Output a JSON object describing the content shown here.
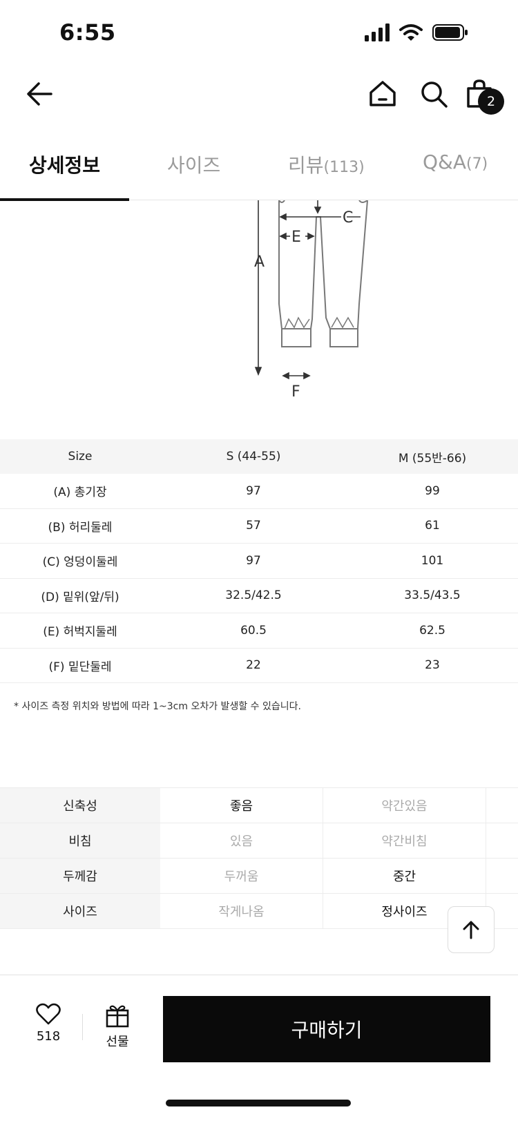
{
  "status": {
    "time": "6:55"
  },
  "nav": {
    "cart_count": "2"
  },
  "tabs": [
    {
      "label": "상세정보",
      "count": ""
    },
    {
      "label": "사이즈",
      "count": ""
    },
    {
      "label": "리뷰",
      "count": "(113)"
    },
    {
      "label": "Q&A",
      "count": "(7)"
    }
  ],
  "diagram": {
    "labels": [
      "A",
      "C",
      "E",
      "F"
    ]
  },
  "size_table": {
    "headers": [
      "Size",
      "S (44-55)",
      "M (55반-66)"
    ],
    "rows": [
      [
        "(A) 총기장",
        "97",
        "99"
      ],
      [
        "(B) 허리둘레",
        "57",
        "61"
      ],
      [
        "(C) 엉덩이둘레",
        "97",
        "101"
      ],
      [
        "(D) 밑위(앞/뒤)",
        "32.5/42.5",
        "33.5/43.5"
      ],
      [
        "(E) 허벅지둘레",
        "60.5",
        "62.5"
      ],
      [
        "(F) 밑단둘레",
        "22",
        "23"
      ]
    ],
    "note": "* 사이즈 측정 위치와 방법에 따라 1~3cm 오차가 발생할 수 있습니다."
  },
  "attributes": [
    {
      "label": "신축성",
      "options": [
        "좋음",
        "약간있음"
      ],
      "selected": 0
    },
    {
      "label": "비침",
      "options": [
        "있음",
        "약간비침"
      ],
      "selected": -1
    },
    {
      "label": "두께감",
      "options": [
        "두꺼움",
        "중간"
      ],
      "selected": 1
    },
    {
      "label": "사이즈",
      "options": [
        "작게나옴",
        "정사이즈"
      ],
      "selected": 1
    }
  ],
  "bottom": {
    "like_count": "518",
    "gift_label": "선물",
    "buy_label": "구매하기"
  }
}
